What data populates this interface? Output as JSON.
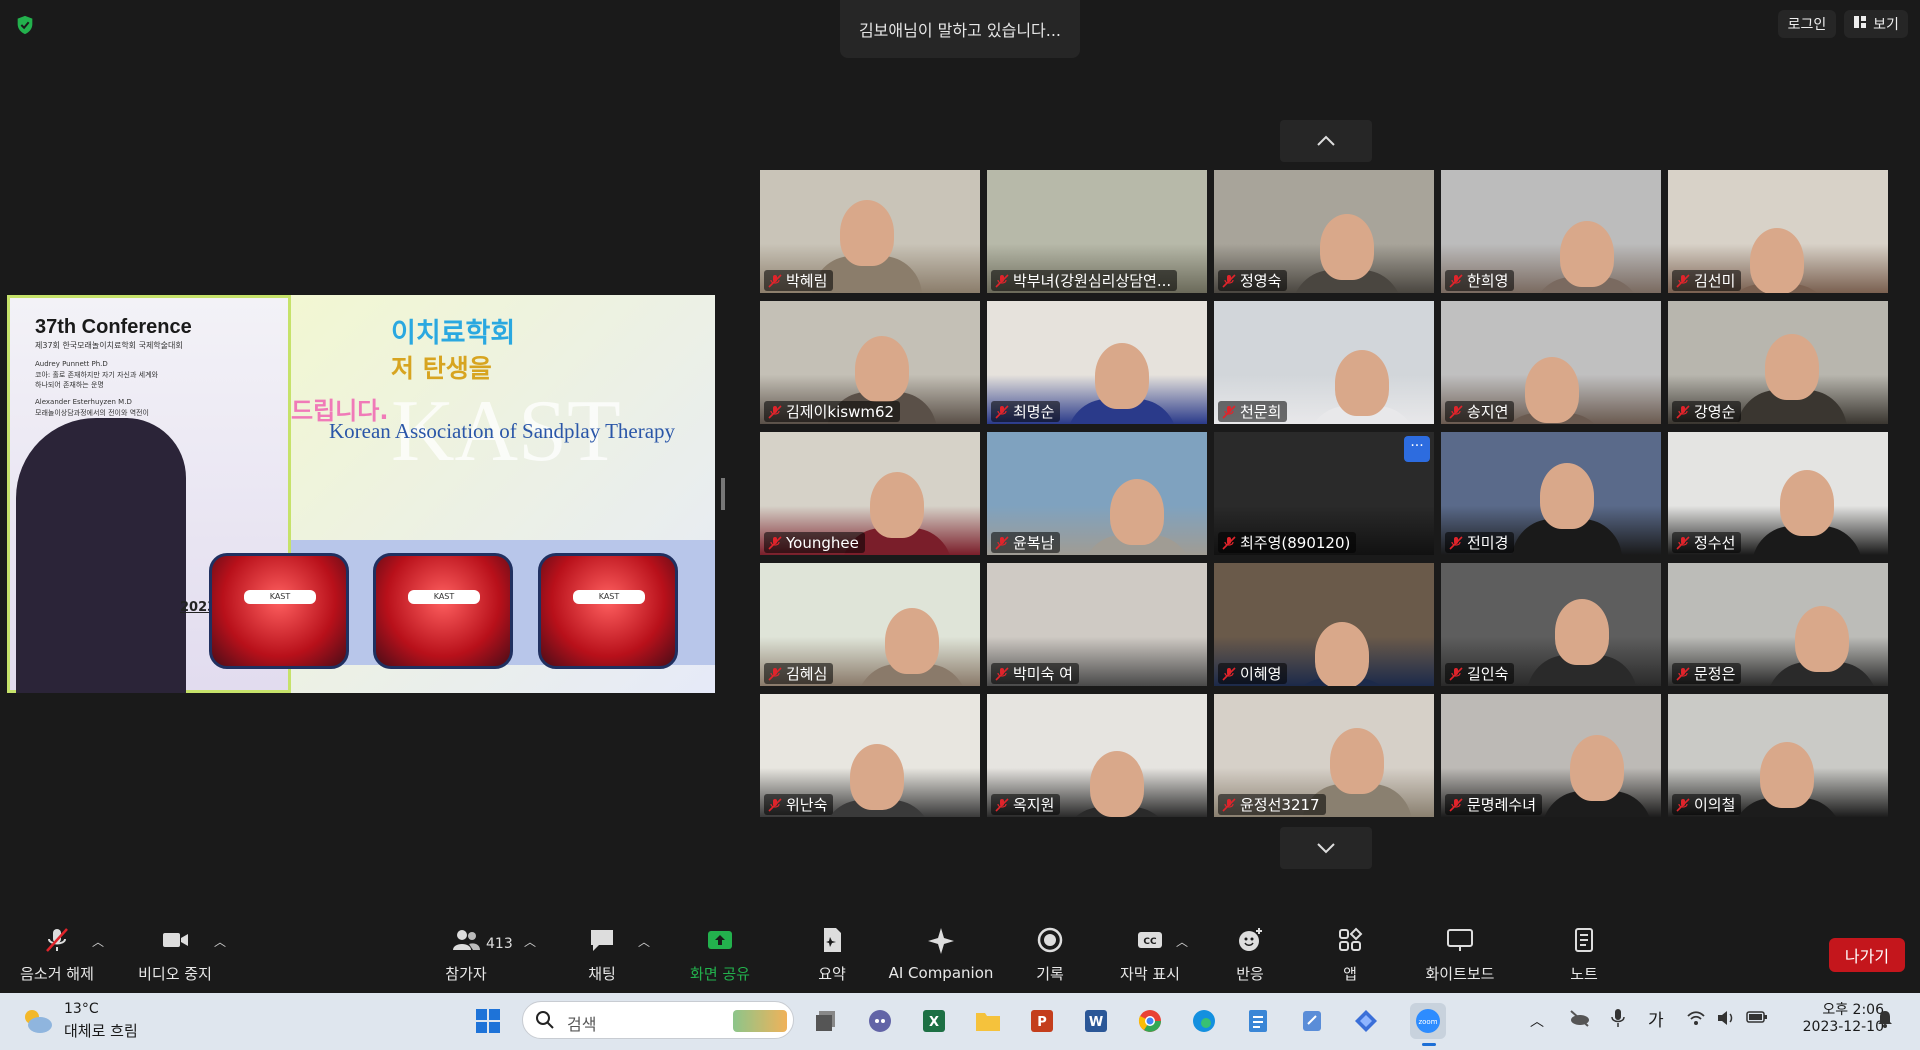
{
  "meeting": {
    "speaking_indicator": "김보애님이 말하고 있습니다...",
    "login_label": "로그인",
    "view_label": "보기",
    "accent_green": "#23b14d",
    "leave_color": "#c4161c"
  },
  "shared_screen": {
    "conference_title": "37th Conference",
    "conference_subtitle": "제37회 한국모래놀이치료학회 국제학술대회",
    "speaker1_name": "Audrey Punnett Ph.D",
    "speaker1_topic_line1": "코아: 홀로 존재하지만 자기 자신과 세계와",
    "speaker1_topic_line2": "하나되어 존재하는 운명",
    "speaker2_name": "Alexander Esterhuyzen M.D",
    "speaker2_topic": "모래놀이상담과정에서의 전이와 역전이",
    "year_label": "2023",
    "banner_line1": "이치료학회",
    "banner_line2": "저 탄생을",
    "banner_line3": "드립니다.",
    "kast_watermark": "KAST",
    "association_name": "Korean Association of Sandplay Therapy",
    "plaque_label": "KAST"
  },
  "participants": [
    {
      "name": "박혜림"
    },
    {
      "name": "박부녀(강원심리상담연..."
    },
    {
      "name": "정영숙"
    },
    {
      "name": "한희영"
    },
    {
      "name": "김선미"
    },
    {
      "name": "김제이kiswm62"
    },
    {
      "name": "최명순"
    },
    {
      "name": "천문희"
    },
    {
      "name": "송지연"
    },
    {
      "name": "강영순"
    },
    {
      "name": "Younghee"
    },
    {
      "name": "윤복남"
    },
    {
      "name": "최주영(890120)"
    },
    {
      "name": "전미경"
    },
    {
      "name": "정수선"
    },
    {
      "name": "김혜심"
    },
    {
      "name": "박미숙 여"
    },
    {
      "name": "이혜영"
    },
    {
      "name": "길인숙"
    },
    {
      "name": "문정은"
    },
    {
      "name": "위난숙"
    },
    {
      "name": "옥지원"
    },
    {
      "name": "윤정선3217"
    },
    {
      "name": "문명례수녀"
    },
    {
      "name": "이의철"
    }
  ],
  "toolbar": {
    "unmute": "음소거 해제",
    "stop_video": "비디오 중지",
    "participants": "참가자",
    "participants_count": "413",
    "chat": "채팅",
    "share_screen": "화면 공유",
    "summary": "요약",
    "ai_companion": "AI Companion",
    "record": "기록",
    "captions": "자막 표시",
    "reactions": "반응",
    "apps": "앱",
    "whiteboard": "화이트보드",
    "notes": "노트",
    "leave": "나가기"
  },
  "taskbar": {
    "weather_temp": "13°C",
    "weather_desc": "대체로 흐림",
    "search_placeholder": "검색",
    "ime_label": "가",
    "time": "오후 2:06",
    "date": "2023-12-10"
  }
}
